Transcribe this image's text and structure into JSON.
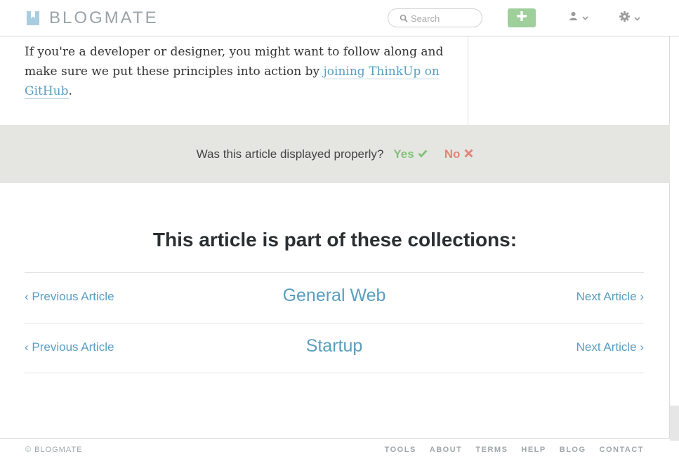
{
  "header": {
    "logo_text": "BLOGMATE",
    "search_placeholder": "Search",
    "add_icon": "plus-icon",
    "user_icon": "user-icon",
    "settings_icon": "gear-icon"
  },
  "article": {
    "text_before_link": "If you're a developer or designer, you might want to follow along and make sure we put these principles into action by ",
    "link_text": "joining ThinkUp on GitHub",
    "text_after_link": "."
  },
  "feedback": {
    "question": "Was this article displayed properly?",
    "yes_label": "Yes",
    "no_label": "No"
  },
  "collections": {
    "title": "This article is part of these collections:",
    "rows": [
      {
        "prev": "‹ Previous Article",
        "name": "General Web",
        "next": "Next Article ›"
      },
      {
        "prev": "‹ Previous Article",
        "name": "Startup",
        "next": "Next Article ›"
      }
    ]
  },
  "footer": {
    "copyright": "© BLOGMATE",
    "links": [
      "TOOLS",
      "ABOUT",
      "TERMS",
      "HELP",
      "BLOG",
      "CONTACT"
    ]
  },
  "colors": {
    "accent_link": "#5a9ec0",
    "yes": "#86c17d",
    "no": "#e2857a",
    "add_button": "#9fcf9a",
    "feedback_bg": "#e5e6e2"
  }
}
